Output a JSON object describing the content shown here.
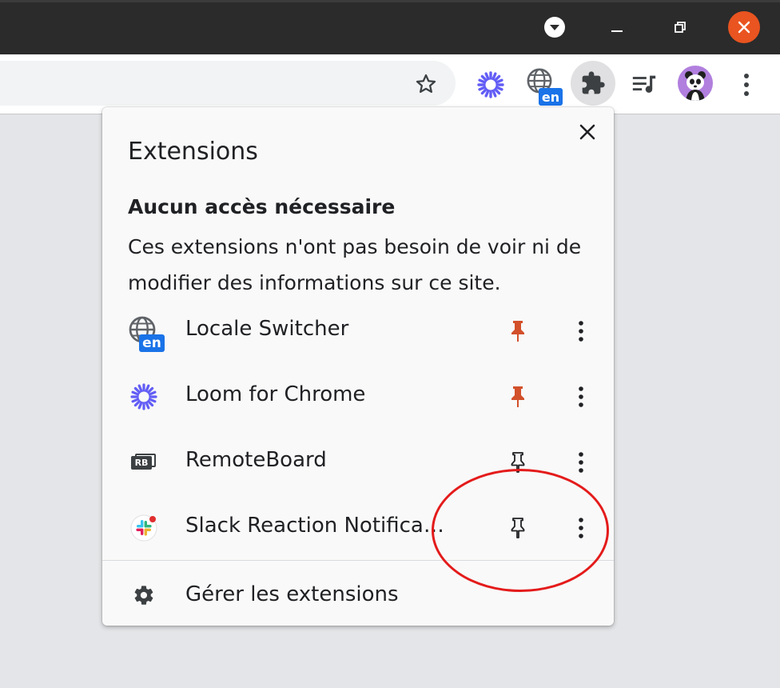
{
  "window": {
    "controls": [
      "dropdown-icon",
      "minimize-icon",
      "restore-icon",
      "close-icon"
    ],
    "close_color": "#e95420"
  },
  "toolbar": {
    "icons": [
      "star-icon",
      "loom-icon",
      "locale-switcher-icon",
      "extensions-puzzle-icon",
      "media-queue-icon",
      "profile-avatar",
      "kebab-menu-icon"
    ],
    "locale_badge": "en"
  },
  "extensions_panel": {
    "title": "Extensions",
    "section_title": "Aucun accès nécessaire",
    "section_desc": "Ces extensions n'ont pas besoin de voir ni de modifier des informations sur ce site.",
    "items": [
      {
        "name": "Locale Switcher",
        "icon": "locale-switcher-icon",
        "badge": "en",
        "pinned": true
      },
      {
        "name": "Loom for Chrome",
        "icon": "loom-icon",
        "pinned": true
      },
      {
        "name": "RemoteBoard",
        "icon": "remoteboard-icon",
        "badge": "RB",
        "pinned": false
      },
      {
        "name": "Slack Reaction Notifica…",
        "icon": "slack-icon",
        "pinned": false
      }
    ],
    "manage_label": "Gérer les extensions"
  },
  "colors": {
    "pinned": "#d2502a",
    "unpinned": "#202124",
    "loom": "#625df5",
    "badge": "#1a73e8",
    "annotation": "#e41b1b"
  }
}
